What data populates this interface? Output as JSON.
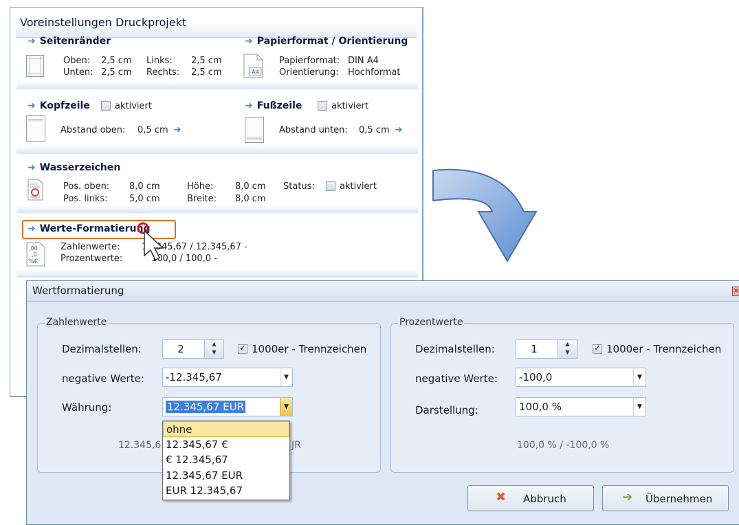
{
  "panel": {
    "title": "Voreinstellungen Druckprojekt",
    "arrow_glyph": "➜",
    "margins": {
      "heading": "Seitenränder",
      "top_label": "Oben:",
      "top_value": "2,5 cm",
      "bottom_label": "Unten:",
      "bottom_value": "2,5 cm",
      "left_label": "Links:",
      "left_value": "2,5 cm",
      "right_label": "Rechts:",
      "right_value": "2,5 cm"
    },
    "paper": {
      "heading": "Papierformat / Orientierung",
      "format_label": "Papierformat:",
      "format_value": "DIN A4",
      "orient_label": "Orientierung:",
      "orient_value": "Hochformat",
      "icon_text": "A4"
    },
    "header": {
      "heading": "Kopfzeile",
      "checkbox_label": "aktiviert",
      "distance_label": "Abstand oben:",
      "distance_value": "0,5 cm"
    },
    "footer": {
      "heading": "Fußzeile",
      "checkbox_label": "aktiviert",
      "distance_label": "Abstand unten:",
      "distance_value": "0,5 cm"
    },
    "watermark": {
      "heading": "Wasserzeichen",
      "pos_top_label": "Pos. oben:",
      "pos_top_value": "8,0 cm",
      "pos_left_label": "Pos. links:",
      "pos_left_value": "5,0 cm",
      "height_label": "Höhe:",
      "height_value": "8,0 cm",
      "width_label": "Breite:",
      "width_value": "8,0 cm",
      "status_label": "Status:",
      "checkbox_label": "aktiviert"
    },
    "formatting": {
      "heading": "Werte-Formatierung",
      "numbers_label": "Zahlenwerte:",
      "numbers_value": "12.345,67  /  12.345,67 -",
      "percent_label": "Prozentwerte:",
      "percent_value": "100,0  /  100,0 -"
    }
  },
  "dialog": {
    "title": "Wertformatierung",
    "close_glyph": "×",
    "numbers": {
      "group_label": "Zahlenwerte",
      "decimals_label": "Dezimalstellen:",
      "decimals_value": "2",
      "thousands_label": "1000er - Trennzeichen",
      "negative_label": "negative Werte:",
      "negative_value": "-12.345,67",
      "currency_label": "Währung:",
      "currency_value": "12.345,67 EUR",
      "preview_left": "12.345,6",
      "preview_right": "JR"
    },
    "percent": {
      "group_label": "Prozentwerte",
      "decimals_label": "Dezimalstellen:",
      "decimals_value": "1",
      "thousands_label": "1000er - Trennzeichen",
      "negative_label": "negative Werte:",
      "negative_value": "-100,0",
      "display_label": "Darstellung:",
      "display_value": "100,0 %",
      "preview": "100,0 %   /  -100,0 %"
    },
    "currency_options": [
      "ohne",
      "12.345,67 €",
      "€ 12.345,67",
      "12.345,67 EUR",
      "EUR 12.345,67"
    ],
    "cancel_label": "Abbruch",
    "apply_label": "Übernehmen"
  }
}
